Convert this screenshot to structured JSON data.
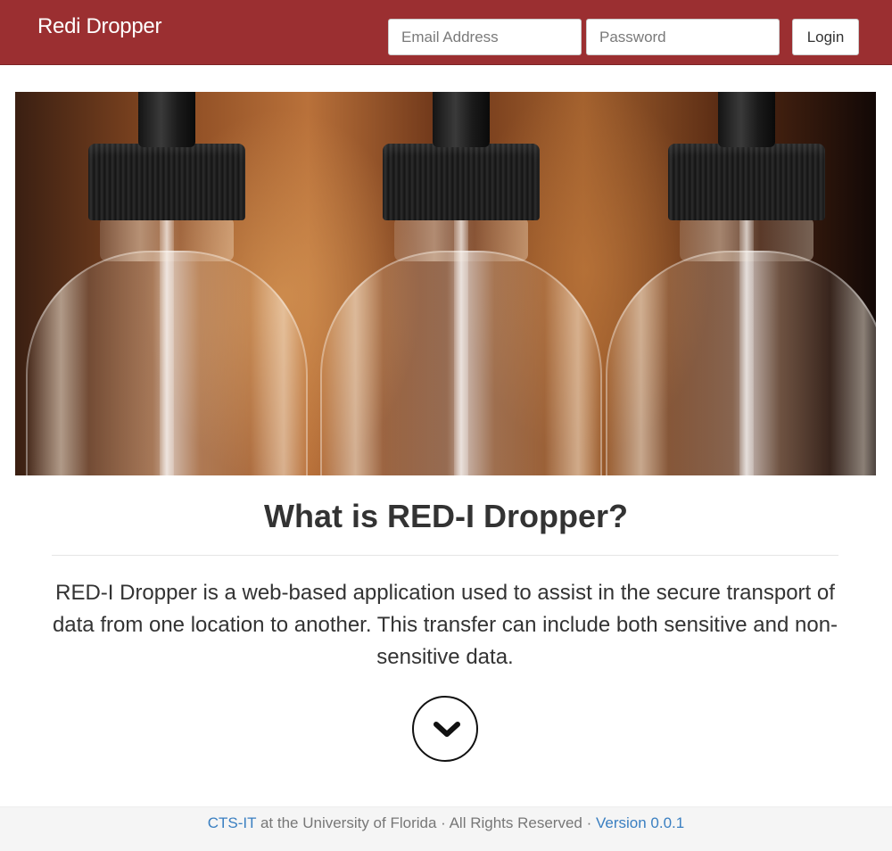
{
  "navbar": {
    "brand": "Redi Dropper",
    "email_placeholder": "Email Address",
    "password_placeholder": "Password",
    "login_label": "Login",
    "background_color": "#9b2f31"
  },
  "hero": {
    "image_subject": "three glass dropper bottles with black caps"
  },
  "main": {
    "heading": "What is RED-I Dropper?",
    "description": "RED-I Dropper is a web-based application used to assist in the secure transport of data from one location to another. This transfer can include both sensitive and non-sensitive data.",
    "scroll_icon": "chevron-down-icon"
  },
  "footer": {
    "org_link": "CTS-IT",
    "text_middle": " at the University of Florida · All Rights Reserved · ",
    "version_link": "Version 0.0.1",
    "link_color": "#3a7fc1"
  }
}
